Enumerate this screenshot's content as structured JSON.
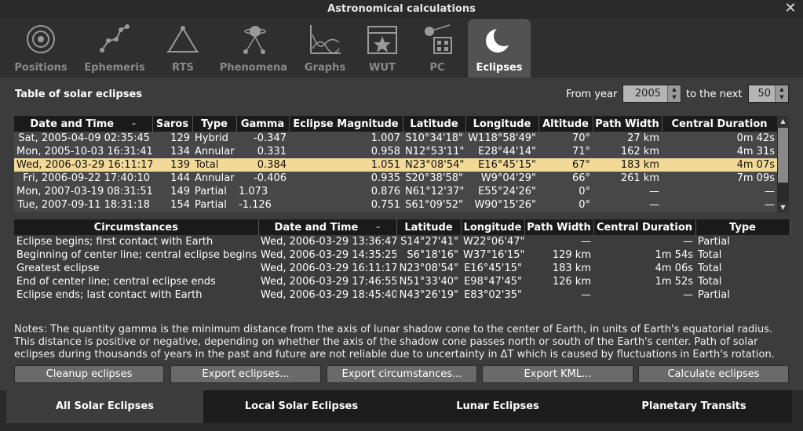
{
  "window": {
    "title": "Astronomical calculations"
  },
  "tabs": [
    {
      "label": "Positions",
      "icon": "positions-icon"
    },
    {
      "label": "Ephemeris",
      "icon": "ephemeris-icon"
    },
    {
      "label": "RTS",
      "icon": "rts-icon"
    },
    {
      "label": "Phenomena",
      "icon": "phenomena-icon"
    },
    {
      "label": "Graphs",
      "icon": "graphs-icon"
    },
    {
      "label": "WUT",
      "icon": "wut-icon"
    },
    {
      "label": "PC",
      "icon": "pc-icon"
    },
    {
      "label": "Eclipses",
      "icon": "eclipses-icon"
    }
  ],
  "main": {
    "heading": "Table of solar eclipses",
    "from_year_label": "From year",
    "from_year_value": "2005",
    "next_label": "to the next",
    "next_value": "50"
  },
  "eclipse_table": {
    "columns": [
      "Date and Time",
      "Saros",
      "Type",
      "Gamma",
      "Eclipse Magnitude",
      "Latitude",
      "Longitude",
      "Altitude",
      "Path Width",
      "Central Duration"
    ],
    "rows": [
      [
        "Sat, 2005-04-09 02:35:45",
        "129",
        "Hybrid",
        "-0.347",
        "1.007",
        "S10°34'18\"",
        "W118°58'49\"",
        "70°",
        "27 km",
        "0m 42s"
      ],
      [
        "Mon, 2005-10-03 16:31:41",
        "134",
        "Annular",
        "0.331",
        "0.958",
        "N12°53'11\"",
        "E28°44'14\"",
        "71°",
        "162 km",
        "4m 31s"
      ],
      [
        "Wed, 2006-03-29 16:11:17",
        "139",
        "Total",
        "0.384",
        "1.051",
        "N23°08'54\"",
        "E16°45'15\"",
        "67°",
        "183 km",
        "4m 07s"
      ],
      [
        "Fri, 2006-09-22 17:40:10",
        "144",
        "Annular",
        "-0.406",
        "0.935",
        "S20°38'58\"",
        "W9°04'29\"",
        "66°",
        "261 km",
        "7m 09s"
      ],
      [
        "Mon, 2007-03-19 08:31:51",
        "149",
        "Partial",
        "1.073",
        "0.876",
        "N61°12'37\"",
        "E55°24'26\"",
        "0°",
        "—",
        "—"
      ],
      [
        "Tue, 2007-09-11 18:31:18",
        "154",
        "Partial",
        "-1.126",
        "0.751",
        "S61°09'52\"",
        "W90°15'26\"",
        "0°",
        "—",
        "—"
      ]
    ],
    "selected_row": 2
  },
  "circumstances_table": {
    "columns": [
      "Circumstances",
      "Date and Time",
      "Latitude",
      "Longitude",
      "Path Width",
      "Central Duration",
      "Type"
    ],
    "rows": [
      [
        "Eclipse begins; first contact with Earth",
        "Wed, 2006-03-29 13:36:47",
        "S14°27'41\"",
        "W22°06'47\"",
        "—",
        "—",
        "Partial"
      ],
      [
        "Beginning of center line; central eclipse begins",
        "Wed, 2006-03-29 14:35:25",
        "S6°18'16\"",
        "W37°16'15\"",
        "129 km",
        "1m 54s",
        "Total"
      ],
      [
        "Greatest eclipse",
        "Wed, 2006-03-29 16:11:17",
        "N23°08'54\"",
        "E16°45'15\"",
        "183 km",
        "4m 06s",
        "Total"
      ],
      [
        "End of center line; central eclipse ends",
        "Wed, 2006-03-29 17:46:55",
        "N51°33'40\"",
        "E98°47'45\"",
        "126 km",
        "1m 52s",
        "Total"
      ],
      [
        "Eclipse ends; last contact with Earth",
        "Wed, 2006-03-29 18:45:40",
        "N43°26'19\"",
        "E83°02'35\"",
        "—",
        "—",
        "Partial"
      ]
    ]
  },
  "notes": "Notes: The quantity gamma is the minimum distance from the axis of lunar shadow cone to the center of Earth, in units of Earth's equatorial radius. This distance is positive or negative, depending on whether the axis of the shadow cone passes north or south of the Earth's center. Path of solar eclipses during thousands of years in the past and future are not reliable due to uncertainty in ΔT which is caused by fluctuations in Earth's rotation.",
  "buttons": {
    "cleanup": "Cleanup eclipses",
    "export_eclipses": "Export eclipses...",
    "export_circumstances": "Export circumstances...",
    "export_kml": "Export KML...",
    "calculate": "Calculate eclipses"
  },
  "bottom_tabs": [
    "All Solar Eclipses",
    "Local Solar Eclipses",
    "Lunar Eclipses",
    "Planetary Transits"
  ],
  "colors": {
    "selected_row": "#f2d995",
    "header_bg": "#1a1a1a",
    "panel_bg": "#3c3c3c"
  }
}
